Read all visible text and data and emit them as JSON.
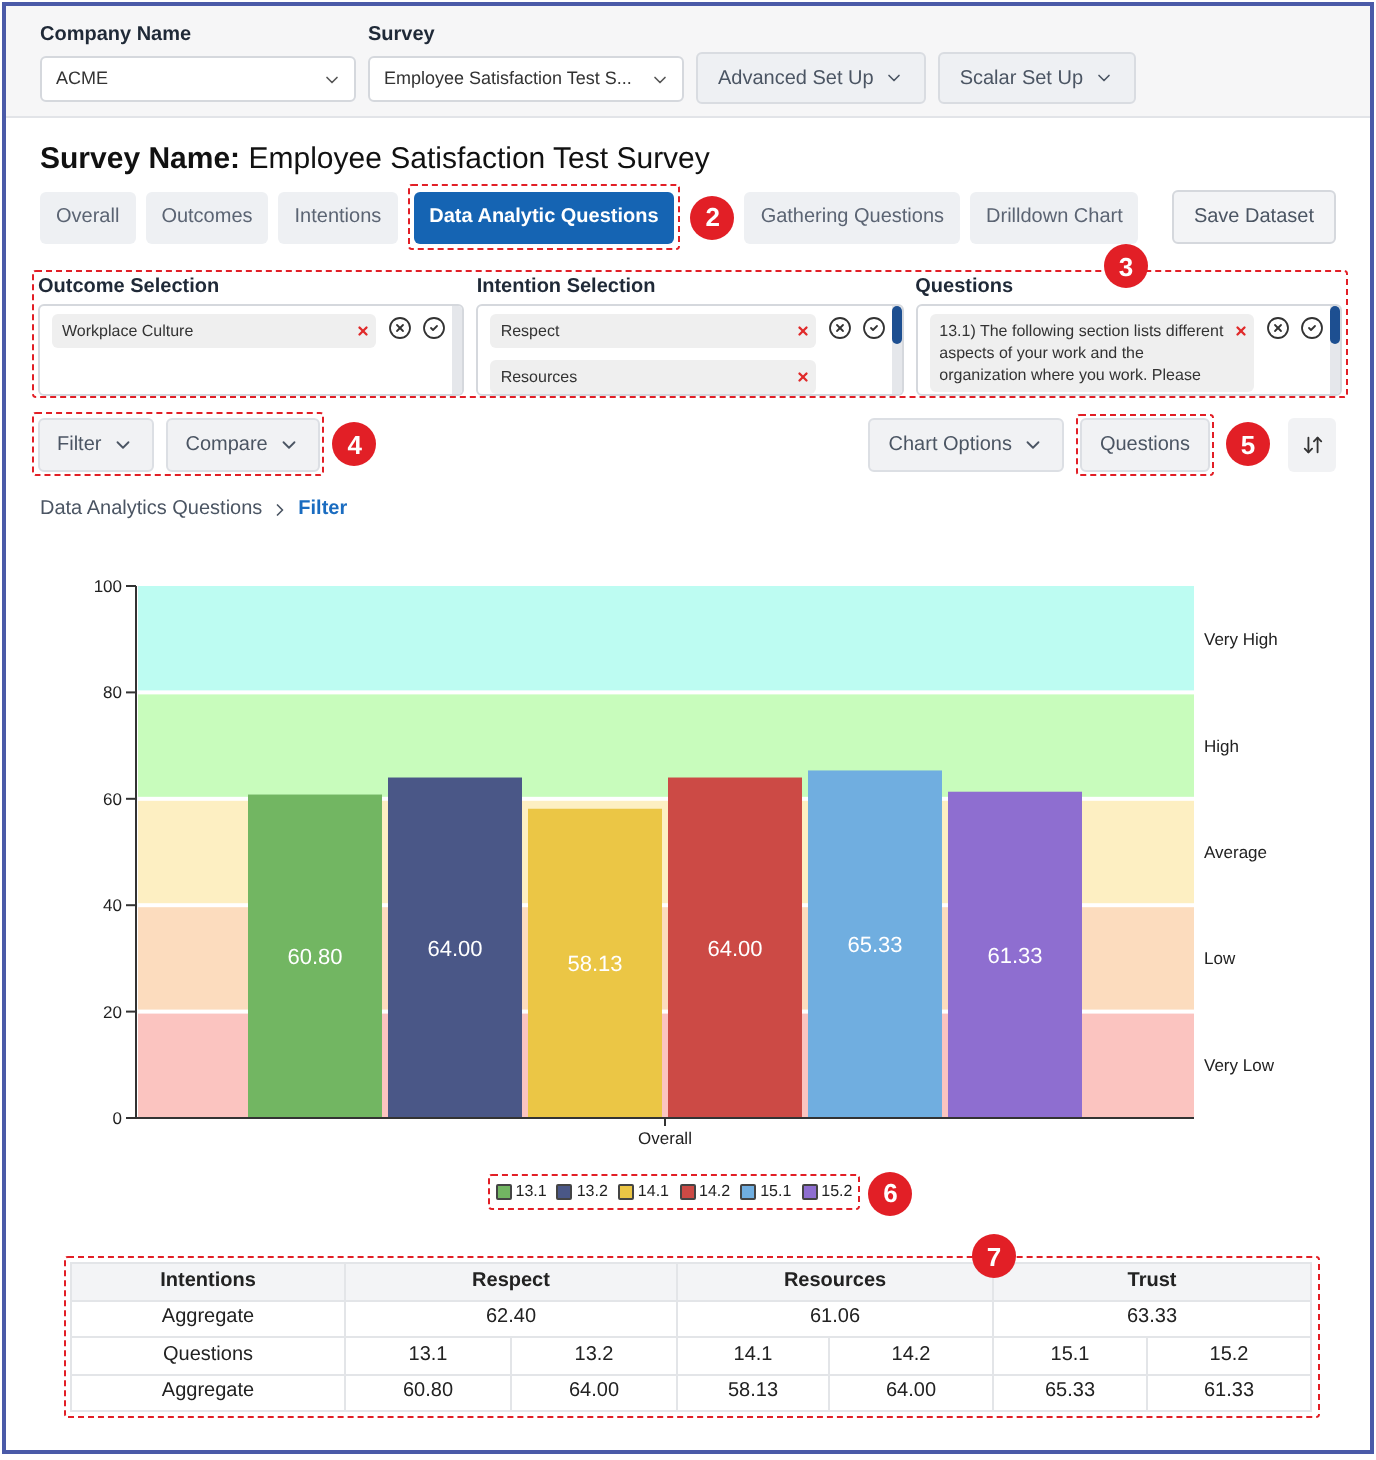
{
  "filters": [
    {
      "label": "Company Name",
      "value": "ACME"
    },
    {
      "label": "Survey",
      "value": "Employee Satisfaction Test S..."
    }
  ],
  "setup_buttons": [
    "Advanced Set Up",
    "Scalar Set Up"
  ],
  "survey_name": {
    "label": "Survey Name:",
    "value": "Employee Satisfaction Test Survey"
  },
  "tabs": [
    {
      "label": "Overall",
      "selected": false
    },
    {
      "label": "Outcomes",
      "selected": false
    },
    {
      "label": "Intentions",
      "selected": false
    },
    {
      "label": "Data Analytic Questions",
      "selected": true,
      "callout": "2"
    },
    {
      "label": "Gathering Questions",
      "selected": false
    },
    {
      "label": "Drilldown Chart",
      "selected": false
    }
  ],
  "save_button": "Save Dataset",
  "selection": {
    "callout": "3",
    "columns": [
      {
        "label": "Outcome Selection",
        "chips": [
          "Workplace Culture"
        ]
      },
      {
        "label": "Intention Selection",
        "chips": [
          "Respect",
          "Resources"
        ]
      },
      {
        "label": "Questions",
        "chips": [
          "13.1) The following section lists different aspects of your work and the organization where you work. Please"
        ]
      }
    ]
  },
  "toolbar": {
    "left": {
      "callout": "4",
      "buttons": [
        {
          "label": "Filter",
          "kind": "dropdown"
        },
        {
          "label": "Compare",
          "kind": "dropdown"
        }
      ]
    },
    "right": [
      {
        "label": "Chart Options",
        "kind": "dropdown"
      },
      {
        "label": "Questions",
        "kind": "plain",
        "callout": "5"
      }
    ]
  },
  "breadcrumb": [
    {
      "label": "Data Analytics Questions",
      "current": false
    },
    {
      "label": "Filter",
      "current": true
    }
  ],
  "chart": {
    "legend_callout": "6",
    "chart_data": {
      "type": "bar",
      "categories": [
        "Overall"
      ],
      "series": [
        {
          "name": "13.1",
          "color": "#72b662",
          "values": [
            60.8
          ],
          "value_labels": [
            "60.80"
          ]
        },
        {
          "name": "13.2",
          "color": "#4a5787",
          "values": [
            64.0
          ],
          "value_labels": [
            "64.00"
          ]
        },
        {
          "name": "14.1",
          "color": "#ebc645",
          "values": [
            58.13
          ],
          "value_labels": [
            "58.13"
          ]
        },
        {
          "name": "14.2",
          "color": "#cc4a45",
          "values": [
            64.0
          ],
          "value_labels": [
            "64.00"
          ]
        },
        {
          "name": "15.1",
          "color": "#70aee0",
          "values": [
            65.33
          ],
          "value_labels": [
            "65.33"
          ]
        },
        {
          "name": "15.2",
          "color": "#8e6ed0",
          "values": [
            61.33
          ],
          "value_labels": [
            "61.33"
          ]
        }
      ],
      "ylim": [
        0,
        100
      ],
      "yticks": [
        0,
        20,
        40,
        60,
        80,
        100
      ],
      "bands": [
        {
          "axis": "y",
          "label": "Very High",
          "from": 80,
          "to": 100,
          "color": "#bdfcf2"
        },
        {
          "axis": "y",
          "label": "High",
          "from": 60,
          "to": 80,
          "color": "#c8fcbc"
        },
        {
          "axis": "y",
          "label": "Average",
          "from": 40,
          "to": 60,
          "color": "#fdefc2"
        },
        {
          "axis": "y",
          "label": "Low",
          "from": 20,
          "to": 40,
          "color": "#fcdcbe"
        },
        {
          "axis": "y",
          "label": "Very Low",
          "from": 0,
          "to": 20,
          "color": "#fbc4c0"
        }
      ]
    }
  },
  "table": {
    "callout": "7",
    "header": [
      {
        "text": "Intentions"
      },
      {
        "text": "Respect",
        "colspan": 2
      },
      {
        "text": "Resources",
        "colspan": 2
      },
      {
        "text": "Trust",
        "colspan": 2
      }
    ],
    "rows": [
      [
        {
          "text": "Aggregate"
        },
        {
          "text": "62.40",
          "colspan": 2
        },
        {
          "text": "61.06",
          "colspan": 2
        },
        {
          "text": "63.33",
          "colspan": 2
        }
      ],
      [
        {
          "text": "Questions"
        },
        {
          "text": "13.1"
        },
        {
          "text": "13.2"
        },
        {
          "text": "14.1"
        },
        {
          "text": "14.2"
        },
        {
          "text": "15.1"
        },
        {
          "text": "15.2"
        }
      ],
      [
        {
          "text": "Aggregate"
        },
        {
          "text": "60.80"
        },
        {
          "text": "64.00"
        },
        {
          "text": "58.13"
        },
        {
          "text": "64.00"
        },
        {
          "text": "65.33"
        },
        {
          "text": "61.33"
        }
      ]
    ]
  }
}
